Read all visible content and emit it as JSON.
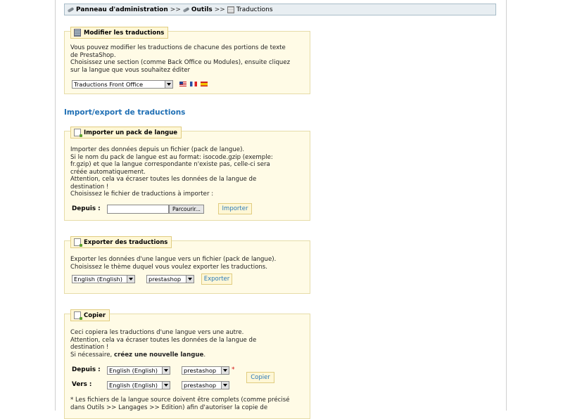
{
  "breadcrumb": {
    "admin": "Panneau d'administration",
    "sep1": ">>",
    "tools": "Outils",
    "sep2": ">>",
    "current": "Traductions"
  },
  "modify": {
    "legend": "Modifier les traductions",
    "text": [
      "Vous pouvez modifier les traductions de chacune des portions de texte",
      "de PrestaShop.",
      "Choisissez une section (comme Back Office ou Modules), ensuite cliquez",
      "sur la langue que vous souhaitez éditer"
    ],
    "select_value": "Traductions Front Office",
    "flags": [
      "flag-en-icon",
      "flag-fr-icon",
      "flag-es-icon"
    ]
  },
  "section_title": "Import/export de traductions",
  "import": {
    "legend": "Importer un pack de langue",
    "text": [
      "Importer des données depuis un fichier (pack de langue).",
      "Si le nom du pack de langue est au format: isocode.gzip (exemple:",
      "fr.gzip) et que la langue correspondante n'existe pas, celle-ci sera",
      "créée automatiquement.",
      "Attention, cela va écraser toutes les données de la langue de",
      "destination !",
      "Choisissez le fichier de traductions à importer :"
    ],
    "from_label": "Depuis :",
    "browse_label": "Parcourir...",
    "button": "Importer"
  },
  "export": {
    "legend": "Exporter des traductions",
    "text": [
      "Exporter les données d'une langue vers un fichier (pack de langue).",
      "Choisissez le thème duquel vous voulez exporter les traductions."
    ],
    "language_value": "English (English)",
    "theme_value": "prestashop",
    "button": "Exporter"
  },
  "copy": {
    "legend": "Copier",
    "text": [
      "Ceci copiera les traductions d'une langue vers une autre.",
      "Attention, cela va écraser toutes les données de la langue de",
      "destination !"
    ],
    "text_prefix": "Si nécessaire, ",
    "text_bold": "créez une nouvelle langue",
    "text_suffix": ".",
    "from_label": "Depuis :",
    "to_label": "Vers :",
    "from_language": "English (English)",
    "from_theme": "prestashop",
    "to_language": "English (English)",
    "to_theme": "prestashop",
    "required_mark": "*",
    "button": "Copier",
    "note": [
      "* Les fichiers de la langue source doivent être complets (comme précisé",
      "dans Outils >> Langages >> Edition) afin d'autoriser la copie de"
    ]
  },
  "colors": {
    "box_bg": "#fffbe6",
    "box_border": "#e6dca8",
    "link_blue": "#1f6fb4",
    "breadcrumb_bg": "#e8eef2"
  }
}
